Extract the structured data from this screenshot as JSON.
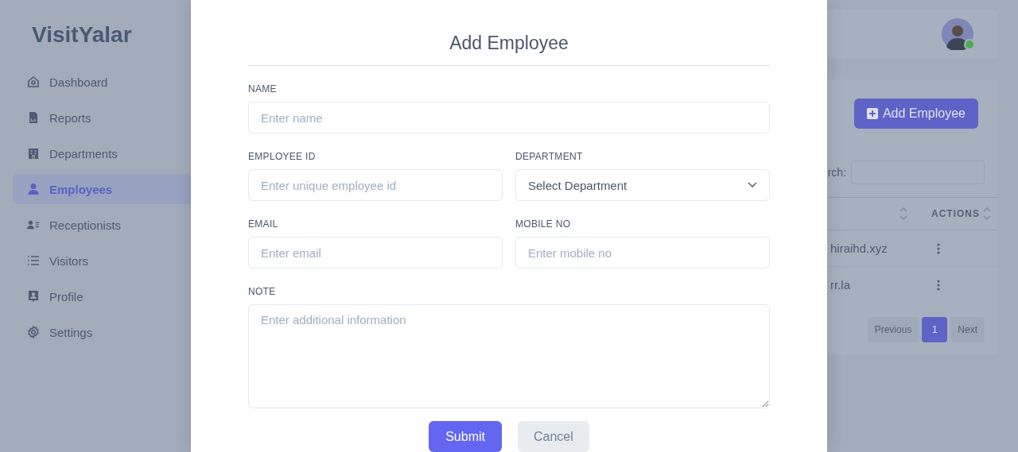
{
  "sidebar": {
    "logo": "VisitYalar",
    "items": [
      {
        "label": "Dashboard",
        "selected": false
      },
      {
        "label": "Reports",
        "selected": false
      },
      {
        "label": "Departments",
        "selected": false
      },
      {
        "label": "Employees",
        "selected": true
      },
      {
        "label": "Receptionists",
        "selected": false
      },
      {
        "label": "Visitors",
        "selected": false
      },
      {
        "label": "Profile",
        "selected": false
      },
      {
        "label": "Settings",
        "selected": false
      }
    ]
  },
  "header": {
    "avatar": {
      "online": true
    }
  },
  "employees_panel": {
    "add_button": "Add Employee",
    "search_label": "rch:",
    "columns": [
      "ACTIONS"
    ],
    "rows": [
      {
        "cell": "hiraihd.xyz"
      },
      {
        "cell": "rr.la"
      }
    ],
    "pagination": {
      "previous": "Previous",
      "pages": [
        {
          "label": "1",
          "selected": true
        }
      ],
      "next": "Next"
    }
  },
  "modal": {
    "title": "Add Employee",
    "rows": [
      [
        {
          "kind": "input",
          "label": "NAME",
          "placeholder": "Enter name"
        }
      ],
      [
        {
          "kind": "input",
          "label": "EMPLOYEE ID",
          "placeholder": "Enter unique employee id"
        },
        {
          "kind": "select",
          "label": "DEPARTMENT",
          "value": "Select Department"
        }
      ],
      [
        {
          "kind": "input",
          "label": "EMAIL",
          "placeholder": "Enter email"
        },
        {
          "kind": "input",
          "label": "MOBILE NO",
          "placeholder": "Enter mobile no"
        }
      ],
      [
        {
          "kind": "textarea",
          "label": "NOTE",
          "placeholder": "Enter additional information"
        }
      ]
    ],
    "buttons": [
      {
        "label": "Submit",
        "kind": "primary"
      },
      {
        "label": "Cancel",
        "kind": "secondary"
      }
    ]
  }
}
